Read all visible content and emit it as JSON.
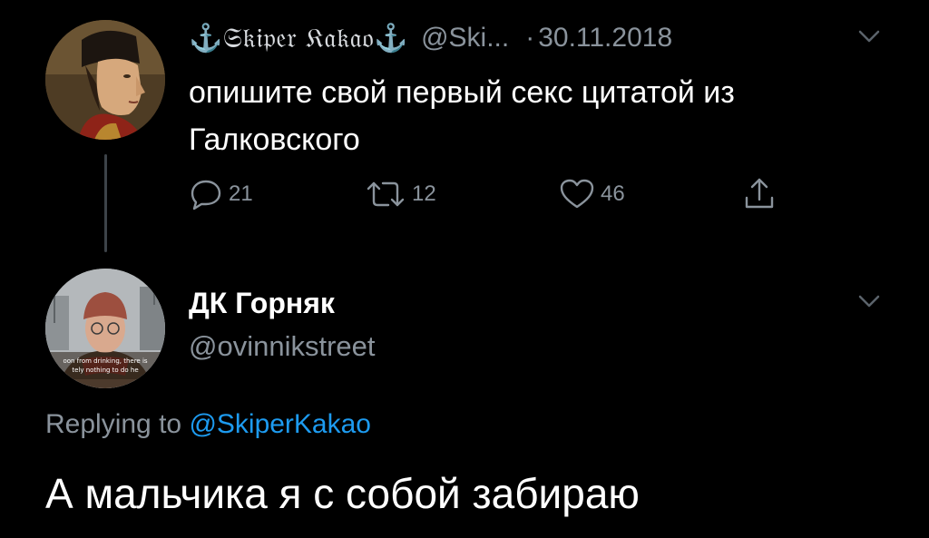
{
  "tweet": {
    "author": {
      "display_name": "⚓𝔖𝔨𝔦𝔭𝔢𝔯 𝔎𝔞𝔨𝔞𝔬⚓",
      "handle": "@Ski...",
      "avatar": "portrait-avatar"
    },
    "separator": "·",
    "date": "30.11.2018",
    "text": "опишите свой первый секс цитатой из Галковского",
    "stats": {
      "replies": "21",
      "retweets": "12",
      "likes": "46"
    }
  },
  "reply": {
    "author": {
      "display_name": "ДК Горняк",
      "handle": "@ovinnikstreet",
      "avatar": "man-in-hat-avatar",
      "avatar_caption": "oon from drinking, there is tely nothing to do he"
    },
    "replying_prefix": "Replying to",
    "replying_handle": "@SkiperKakao",
    "text": "А мальчика я с собой забираю"
  },
  "icons": {
    "reply": "speech-bubble-icon",
    "retweet": "retweet-arrows-icon",
    "like": "heart-icon",
    "share": "share-upload-icon",
    "menu": "chevron-down-icon"
  },
  "colors": {
    "background": "#000000",
    "primary_text": "#ffffff",
    "secondary_text": "#8a939c",
    "link": "#1d9bf0",
    "thread_line": "#3d4349"
  }
}
